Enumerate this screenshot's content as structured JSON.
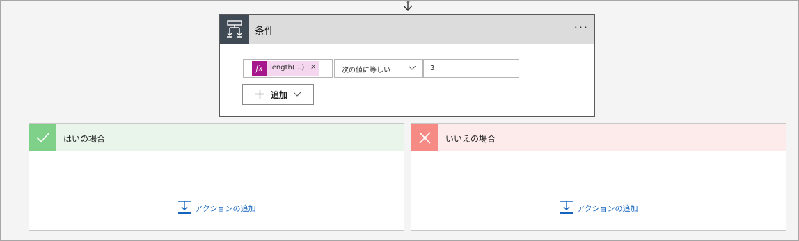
{
  "condition": {
    "title": "条件",
    "more_label": "···",
    "expression": {
      "token_label": "length(...)",
      "token_icon": "fx-icon",
      "token_remove": "×",
      "operator": "次の値に等しい",
      "value": "3"
    },
    "add_label": "追加"
  },
  "branches": {
    "yes": {
      "title": "はいの場合",
      "add_action_label": "アクションの追加",
      "icon": "checkmark-icon",
      "color": "#7fd18a"
    },
    "no": {
      "title": "いいえの場合",
      "add_action_label": "アクションの追加",
      "icon": "close-icon",
      "color": "#f58b84"
    }
  }
}
